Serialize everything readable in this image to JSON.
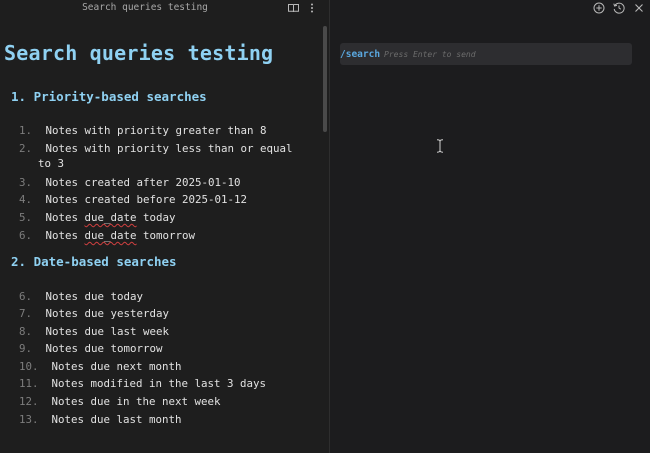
{
  "editor": {
    "header_title": "Search queries testing",
    "title": "Search queries testing",
    "sections": [
      {
        "heading": "1. Priority-based searches",
        "items": [
          {
            "num": "1.",
            "text": "Notes with priority greater than 8"
          },
          {
            "num": "2.",
            "text": "Notes with priority less than or equal",
            "cont": "to 3"
          },
          {
            "num": "3.",
            "text": "Notes created after 2025-01-10"
          },
          {
            "num": "4.",
            "text": "Notes created before 2025-01-12"
          },
          {
            "num": "5.",
            "pre": "Notes ",
            "flag": "due_date",
            "post": " today"
          },
          {
            "num": "6.",
            "pre": "Notes ",
            "flag": "due_date",
            "post": " tomorrow"
          }
        ]
      },
      {
        "heading": "2. Date-based searches",
        "items": [
          {
            "num": "6.",
            "text": "Notes due today"
          },
          {
            "num": "7.",
            "text": "Notes due yesterday"
          },
          {
            "num": "8.",
            "text": "Notes due last week"
          },
          {
            "num": "9.",
            "text": "Notes due tomorrow"
          },
          {
            "num": "10.",
            "text": "Notes due next month"
          },
          {
            "num": "11.",
            "text": "Notes modified in the last 3 days"
          },
          {
            "num": "12.",
            "text": "Notes due in the next week"
          },
          {
            "num": "13.",
            "text": "Notes due last month"
          }
        ]
      }
    ],
    "icons": [
      "book-open-icon",
      "more-vertical-icon"
    ]
  },
  "chat": {
    "command": "/search",
    "hint": "Press Enter to send",
    "icons": [
      "add-circle-icon",
      "history-icon",
      "close-icon"
    ]
  },
  "colors": {
    "heading": "#8fd1f2",
    "command": "#5aa8e0",
    "background": "#1e1e1e",
    "input_bg": "#2d2d30",
    "spell_error": "#d04040"
  }
}
